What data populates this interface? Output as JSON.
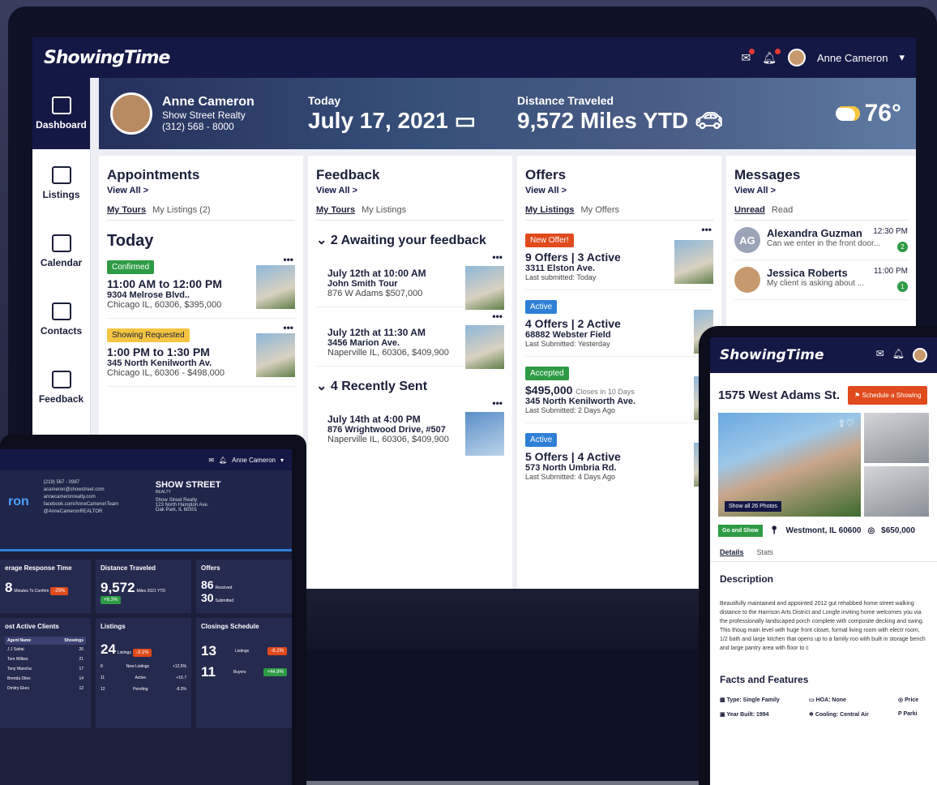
{
  "app": {
    "name": "ShowingTime",
    "user": "Anne Cameron"
  },
  "sidebar": {
    "items": [
      {
        "label": "Dashboard"
      },
      {
        "label": "Listings"
      },
      {
        "label": "Calendar"
      },
      {
        "label": "Contacts"
      },
      {
        "label": "Feedback"
      }
    ]
  },
  "hero": {
    "name": "Anne Cameron",
    "company": "Show Street Realty",
    "phone": "(312) 568 - 8000",
    "today_label": "Today",
    "today_value": "July 17, 2021",
    "distance_label": "Distance Traveled",
    "distance_value": "9,572 Miles YTD",
    "temperature": "76°"
  },
  "appointments": {
    "title": "Appointments",
    "view_all": "View All >",
    "tabs": [
      "My Tours",
      "My Listings (2)"
    ],
    "heading": "Today",
    "items": [
      {
        "badge": "Confirmed",
        "time": "11:00 AM to 12:00 PM",
        "address": "9304 Melrose Blvd..",
        "detail": "Chicago IL, 60306, $395,000"
      },
      {
        "badge": "Showing Requested",
        "time": "1:00 PM to 1:30 PM",
        "address": "345 North Kenilworth Av.",
        "detail": "Chicago IL, 60306 - $498,000"
      }
    ]
  },
  "feedback": {
    "title": "Feedback",
    "view_all": "View All >",
    "tabs": [
      "My Tours",
      "My Listings"
    ],
    "group1": "2 Awaiting your feedback",
    "group2": "4 Recently Sent",
    "items": [
      {
        "time": "July 12th at 10:00 AM",
        "line": "John Smith Tour",
        "detail": "876 W Adams $507,000"
      },
      {
        "time": "July 12th at 11:30 AM",
        "line": "3456 Marion Ave.",
        "detail": "Naperville IL, 60306, $409,900"
      },
      {
        "time": "July 14th at 4:00 PM",
        "line": "876 Wrightwood Drive, #507",
        "detail": "Naperville IL, 60306, $409,900"
      }
    ]
  },
  "offers": {
    "title": "Offers",
    "view_all": "View All >",
    "tabs": [
      "My Listings",
      "My Offers"
    ],
    "items": [
      {
        "badge": "New Offer!",
        "count": "9 Offers | 3 Active",
        "address": "3311 Elston Ave.",
        "sub": "Last submitted: Today"
      },
      {
        "badge": "Active",
        "count": "4 Offers | 2 Active",
        "address": "68882 Webster Field",
        "sub": "Last Submitted: Yesterday"
      },
      {
        "badge": "Accepted",
        "count": "$495,000",
        "note": "Closes in 10 Days",
        "address": "345 North Kenilworth Ave.",
        "sub": "Last Submitted: 2 Days Ago"
      },
      {
        "badge": "Active",
        "count": "5 Offers | 4 Active",
        "address": "573 North Umbria Rd.",
        "sub": "Last Submitted: 4 Days Ago"
      }
    ]
  },
  "messages": {
    "title": "Messages",
    "view_all": "View All >",
    "tabs": [
      "Unread",
      "Read"
    ],
    "items": [
      {
        "initials": "AG",
        "name": "Alexandra Guzman",
        "time": "12:30 PM",
        "text": "Can we enter in the front door...",
        "count": "2"
      },
      {
        "initials": "",
        "name": "Jessica Roberts",
        "time": "11:00 PM",
        "text": "My client is asking about ...",
        "count": "1"
      }
    ]
  },
  "laptop": {
    "name": "ron",
    "company": "SHOW STREET",
    "company_sub": "REALTY",
    "contact_lines": [
      "(219) 567 - 0987",
      "acameron@showstreet.com",
      "annecameronrealty.com",
      "facebook.com/AnneCameronTeam",
      "@AnneCameronREALTOR"
    ],
    "address_lines": [
      "Show Street Realty",
      "123 North Hampton Ave.",
      "Oak Park, IL 60301"
    ],
    "response_title": "erage Response Time",
    "response_value": "8",
    "response_unit": "Minutes To Confirm",
    "response_pill": "-25%",
    "distance_title": "Distance Traveled",
    "distance_value": "9,572",
    "distance_unit": "Miles 2021 YTD",
    "distance_pill": "+6.3%",
    "offers_title": "Offers",
    "offers_received": "86",
    "offers_received_label": "Received",
    "offers_submitted": "30",
    "offers_submitted_label": "Submitted",
    "clients_title": "ost Active Clients",
    "clients_header": [
      "Agent Name",
      "Showings"
    ],
    "clients": [
      [
        "J J Sahai",
        "26"
      ],
      [
        "Tom Wilkes",
        "21"
      ],
      [
        "Tony Mancha",
        "17"
      ],
      [
        "Brenda Diles",
        "14"
      ],
      [
        "Dmitry Ekes",
        "12"
      ]
    ],
    "listings_title": "Listings",
    "listings_value": "24",
    "listings_unit": "Listings",
    "listings_pill": "-3.1%",
    "listings_rows": [
      [
        "8",
        "New Listings",
        "+12.5%"
      ],
      [
        "11",
        "Active",
        "+16.7"
      ],
      [
        "12",
        "Pending",
        "-8.3%"
      ]
    ],
    "closings_title": "Closings Schedule",
    "closings_rows": [
      [
        "13",
        "Listings",
        "-8.2%"
      ],
      [
        "11",
        "Buyers",
        "+44.9%"
      ]
    ]
  },
  "tablet": {
    "address": "1575 West Adams St.",
    "schedule": "Schedule a Showing",
    "show_all": "Show all 26 Photos",
    "tag": "Go and Show",
    "location": "Westmont, IL 60600",
    "price": "$650,000",
    "tabs": [
      "Details",
      "Stats"
    ],
    "desc_title": "Description",
    "description": "Beautifully maintained and appointed 2012 gut rehabbed home street walking distance to the Harrison Arts District and Longfe inviting home welcomes you via the professionally landscaped porch complete with composite decking and swing. This thoug main level with huge front closet, formal living room with electr room, 1/2 bath and large kitchen that opens up to a family roo with built in storage bench and large pantry area with floor to c",
    "facts_title": "Facts and Features",
    "facts": [
      "Type: Single Family",
      "HOA: None",
      "Price",
      "Year Built: 1994",
      "Cooling: Central Air",
      "Parki"
    ]
  },
  "colors": {
    "navy": "#141845",
    "green": "#2e9b45",
    "orange": "#e04a1c",
    "yellow": "#f5c542",
    "blue": "#2f7fd6"
  }
}
